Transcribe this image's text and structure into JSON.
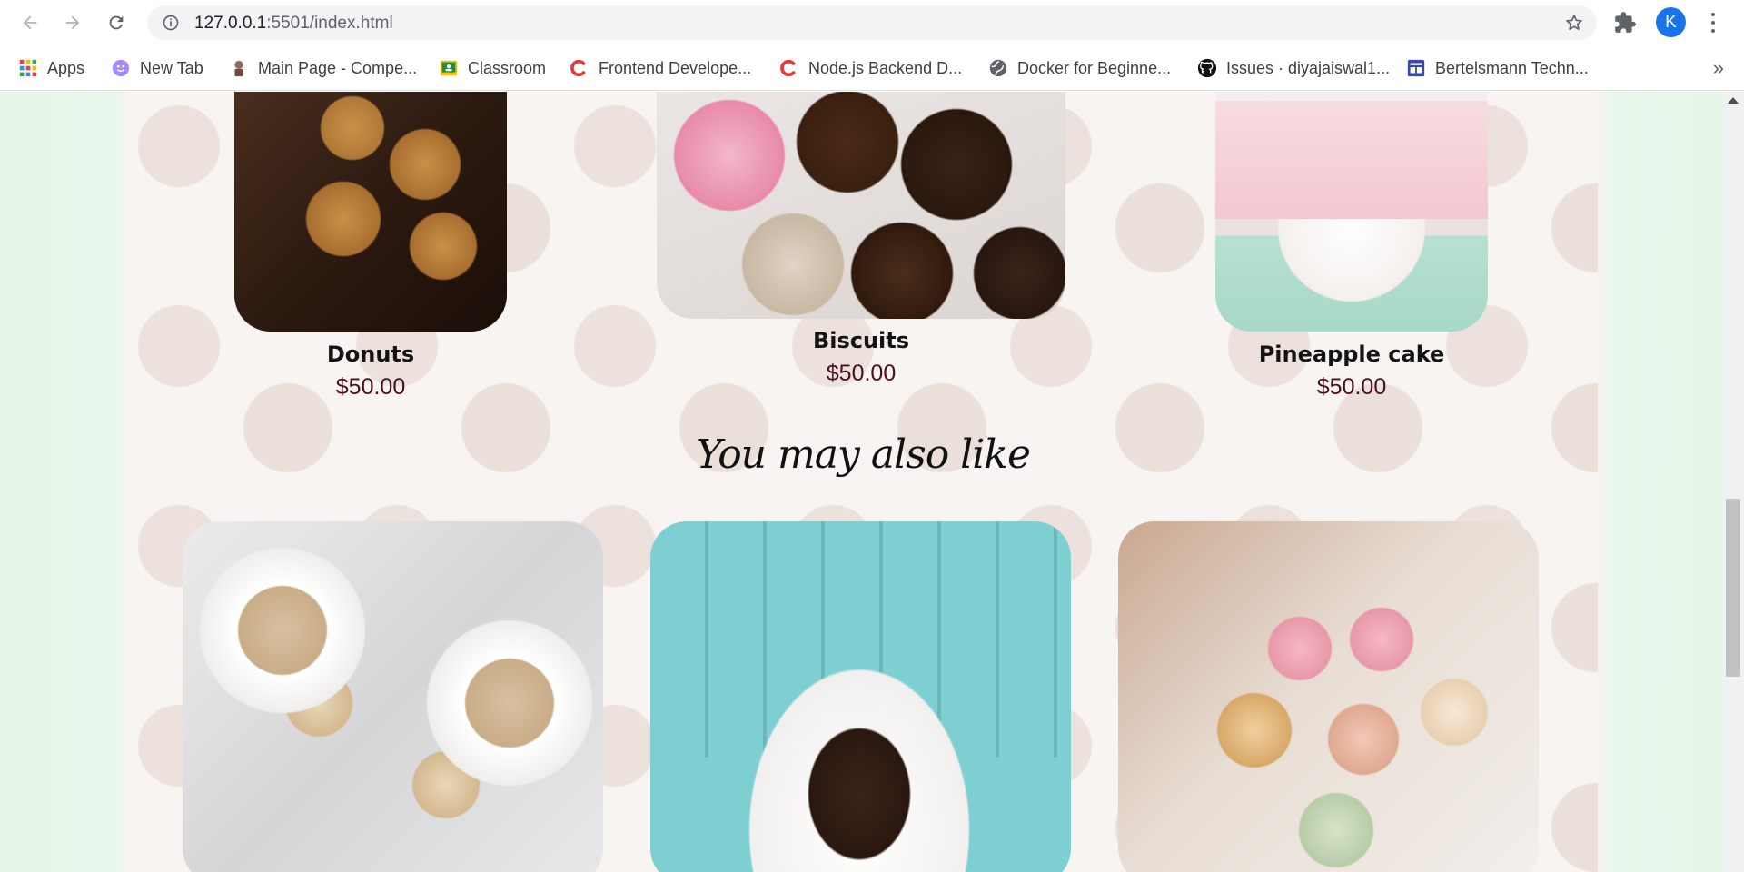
{
  "browser": {
    "url_host": "127.0.0.1",
    "url_rest": ":5501/index.html",
    "profile_initial": "K"
  },
  "bookmarks": [
    {
      "label": "Apps",
      "icon": "apps-grid-icon"
    },
    {
      "label": "New Tab",
      "icon": "new-tab-icon"
    },
    {
      "label": "Main Page - Compe...",
      "icon": "compe-icon"
    },
    {
      "label": "Classroom",
      "icon": "classroom-icon"
    },
    {
      "label": "Frontend Develope...",
      "icon": "codecademy-icon"
    },
    {
      "label": "Node.js Backend D...",
      "icon": "codecademy-icon"
    },
    {
      "label": "Docker for Beginne...",
      "icon": "globe-icon"
    },
    {
      "label": "Issues · diyajaiswal1...",
      "icon": "github-icon"
    },
    {
      "label": "Bertelsmann Techn...",
      "icon": "bertelsmann-icon"
    }
  ],
  "products": [
    {
      "name": "Donuts",
      "price": "$50.00"
    },
    {
      "name": "Biscuits",
      "price": "$50.00"
    },
    {
      "name": "Pineapple cake",
      "price": "$50.00"
    }
  ],
  "section": {
    "title": "You may also like"
  },
  "colors": {
    "accent": "#1a73e8",
    "price": "#4a1020",
    "side_mint": "#e3f5e6"
  }
}
